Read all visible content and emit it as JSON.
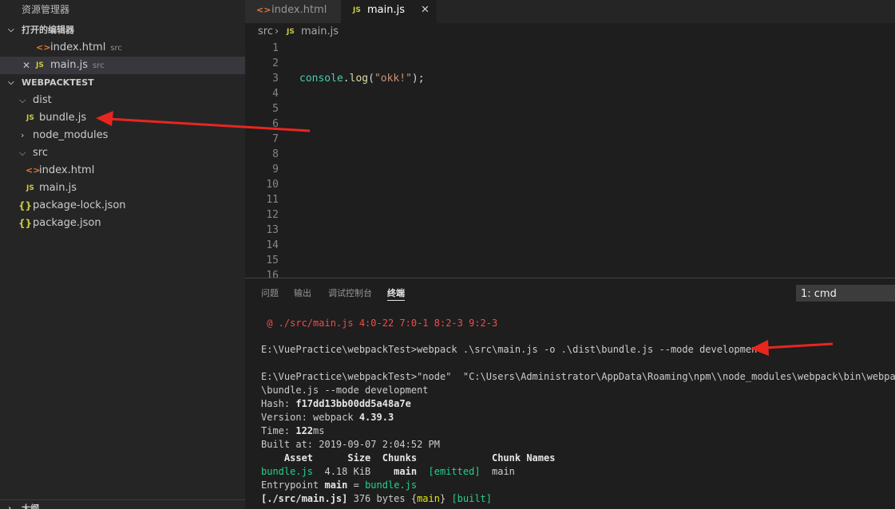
{
  "sidebar": {
    "title": "资源管理器",
    "open_editors": {
      "header": "打开的编辑器",
      "items": [
        {
          "name": "index.html",
          "desc": "src",
          "icon": "html-icon"
        },
        {
          "name": "main.js",
          "desc": "src",
          "icon": "js-icon"
        }
      ]
    },
    "project": {
      "header": "WEBPACKTEST",
      "items": [
        {
          "name": "dist",
          "kind": "folder-open"
        },
        {
          "name": "bundle.js",
          "kind": "js"
        },
        {
          "name": "node_modules",
          "kind": "folder-closed"
        },
        {
          "name": "src",
          "kind": "folder-open"
        },
        {
          "name": "index.html",
          "kind": "html"
        },
        {
          "name": "main.js",
          "kind": "js"
        },
        {
          "name": "package-lock.json",
          "kind": "json"
        },
        {
          "name": "package.json",
          "kind": "json"
        }
      ]
    },
    "outline_header": "大纲"
  },
  "icons": {
    "html": "<>",
    "js": "JS",
    "json": "{}"
  },
  "tabs": [
    {
      "label": "index.html",
      "active": false
    },
    {
      "label": "main.js",
      "active": true,
      "close": "✕"
    }
  ],
  "breadcrumb": {
    "folder": "src",
    "separator": "›",
    "file": "main.js"
  },
  "editor": {
    "line_numbers": [
      "1",
      "2",
      "3",
      "4",
      "5",
      "6",
      "7",
      "8",
      "9",
      "10",
      "11",
      "12",
      "13",
      "14",
      "15",
      "16"
    ],
    "code": {
      "obj": "console",
      "dot": ".",
      "method": "log",
      "open": "(",
      "str": "\"okk!\"",
      "close": ");"
    }
  },
  "panel": {
    "tabs": [
      "问题",
      "输出",
      "调试控制台",
      "终端"
    ],
    "active_tab": "终端",
    "terminal_select": "1: cmd",
    "terminal": {
      "error_line": " @ ./src/main.js 4:0-22 7:0-1 8:2-3 9:2-3",
      "cmd1": "E:\\VuePractice\\webpackTest>webpack .\\src\\main.js -o .\\dist\\bundle.js --mode development",
      "cmd2": "E:\\VuePractice\\webpackTest>\"node\"  \"C:\\Users\\Administrator\\AppData\\Roaming\\npm\\\\node_modules\\webpack\\bin\\webpack.js\"",
      "cmd2_cont": "\\bundle.js --mode development",
      "hash_label": "Hash: ",
      "hash": "f17dd13bb00dd5a48a7e",
      "version_label": "Version: webpack ",
      "version": "4.39.3",
      "time_label": "Time: ",
      "time": "122",
      "time_unit": "ms",
      "built_at_label": "Built at: ",
      "built_at": "2019-09-07 2:04:52 PM",
      "asset_header": "    Asset      Size  Chunks             Chunk Names",
      "asset_name": "bundle.js",
      "asset_size": "  4.18 KiB",
      "asset_chunk": "    main",
      "asset_flag": "  [emitted]",
      "asset_chunkname": "  main",
      "entry_label": "Entrypoint ",
      "entry_name": "main",
      "entry_eq": " = ",
      "entry_file": "bundle.js",
      "module_path": "[./src/main.js]",
      "module_size": " 376 bytes {",
      "module_chunk": "main",
      "module_close": "} ",
      "module_flag": "[built]"
    }
  },
  "colors": {
    "arrow": "#e8261f",
    "sidebar_bg": "#252526",
    "editor_bg": "#1e1e1e"
  }
}
